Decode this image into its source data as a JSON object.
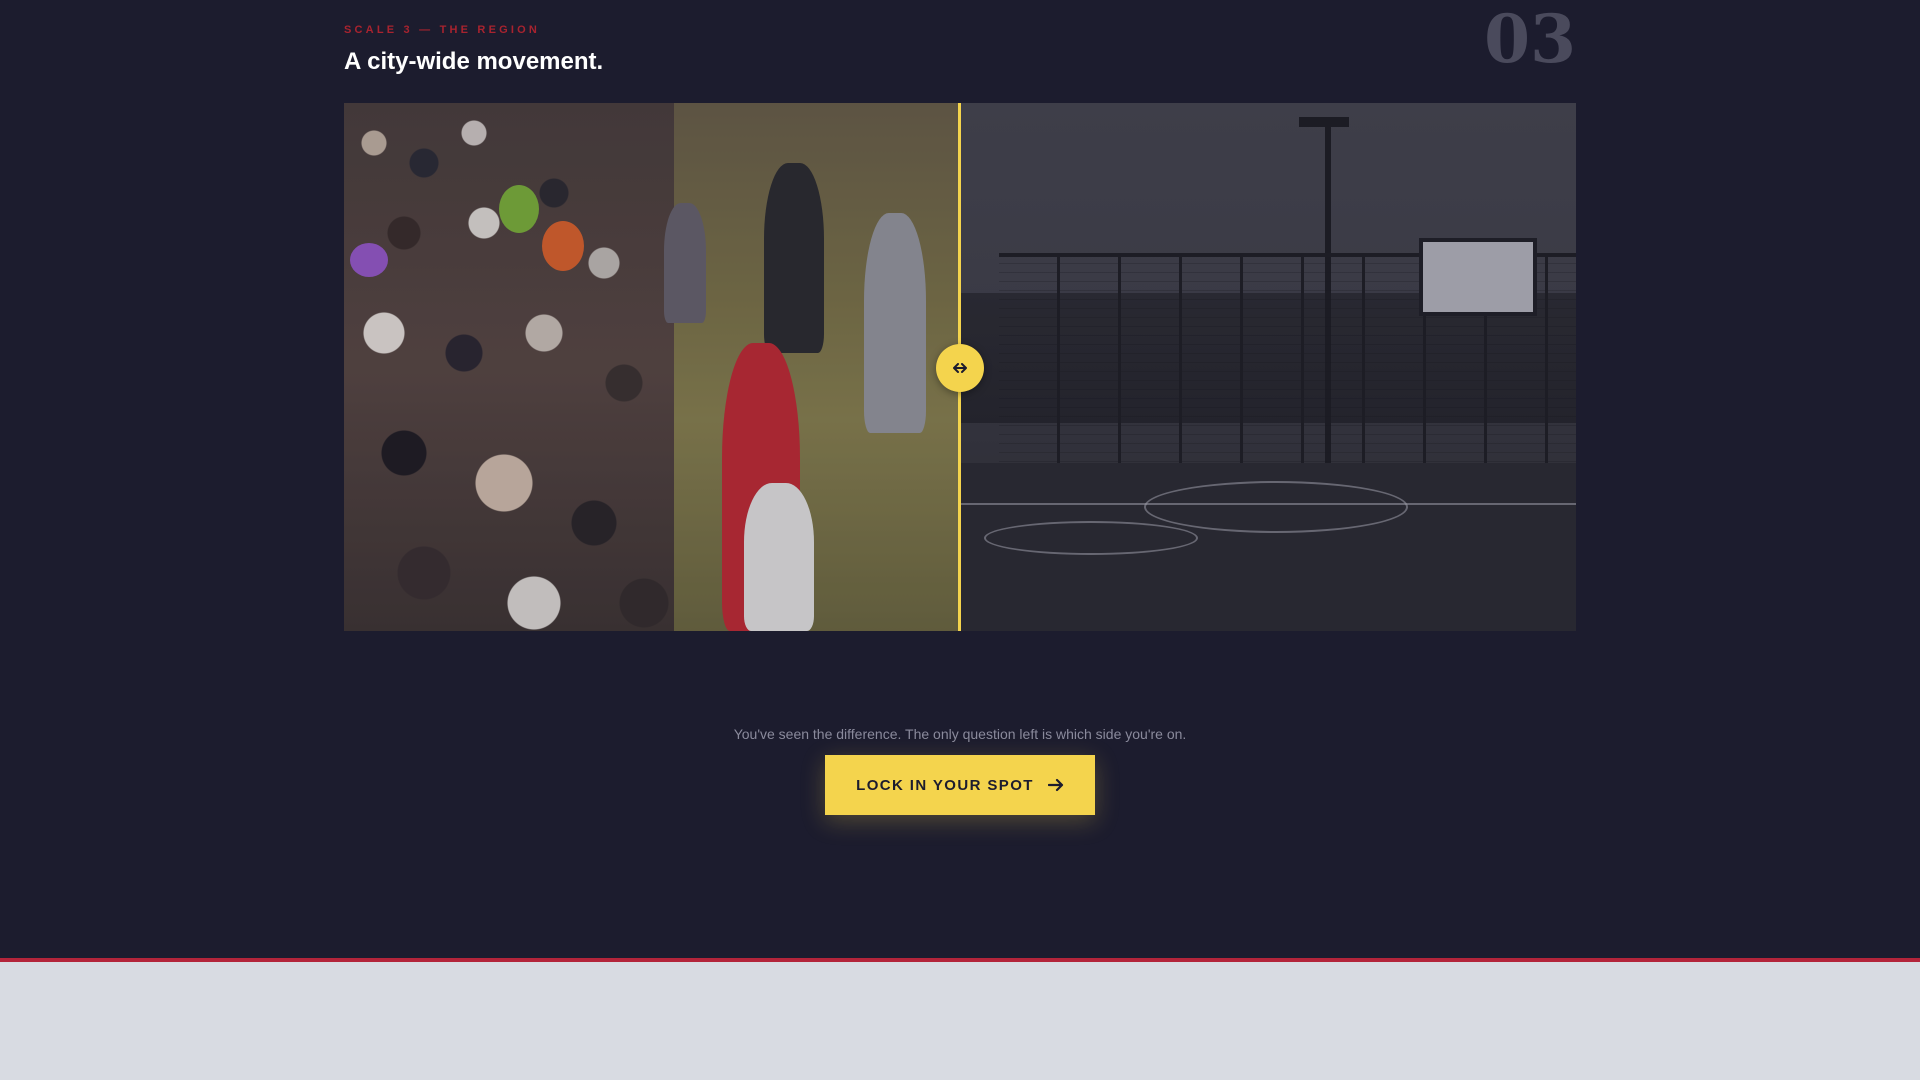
{
  "section": {
    "eyebrow": "SCALE 3 — THE REGION",
    "title": "A city-wide movement.",
    "step_number": "03"
  },
  "comparison": {
    "left_scene": "crowd-photo",
    "right_scene": "empty-court-photo",
    "handle_icon": "arrows-horizontal-icon",
    "position_fraction": 0.5,
    "accent_color": "#f4d44d"
  },
  "cta": {
    "caption": "You've seen the difference. The only question left is which side you're on.",
    "button_label": "LOCK IN YOUR SPOT",
    "button_icon": "arrow-right-icon"
  },
  "colors": {
    "background": "#1c1c2e",
    "eyebrow": "#a8232f",
    "footer_rule": "#b3243a",
    "footer": "#d8dbe2"
  }
}
